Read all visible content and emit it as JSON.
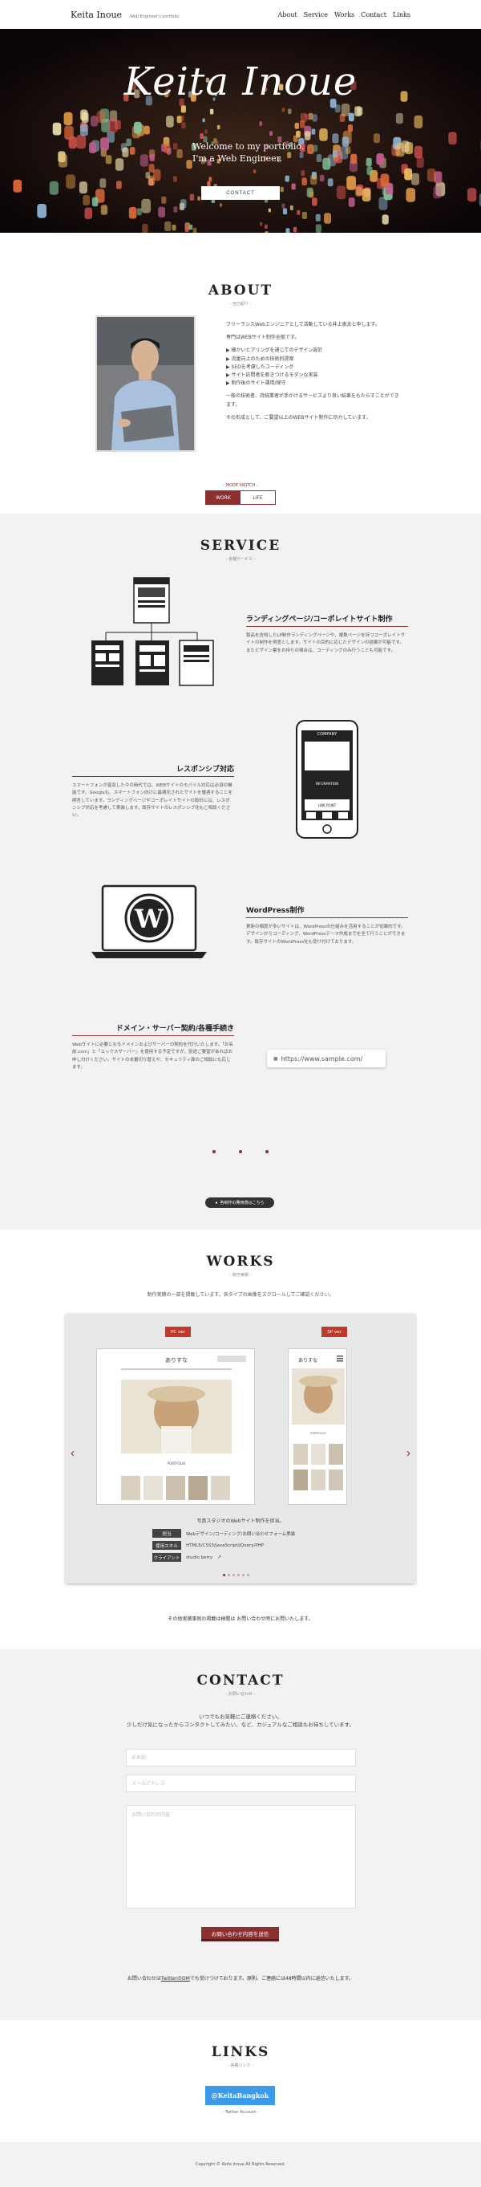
{
  "header": {
    "brand_name": "Keita Inoue",
    "brand_sub": "Web Engineer's portfolio",
    "nav": [
      "About",
      "Service",
      "Works",
      "Contact",
      "Links"
    ]
  },
  "hero": {
    "title": "Keita Inoue",
    "subtitle_line1": "Welcome to my portfolio.",
    "subtitle_line2": "I'm a Web Engineer.",
    "cta": "CONTACT"
  },
  "about": {
    "title": "ABOUT",
    "subtitle": "- 自己紹介 -",
    "p1": "フリーランスWebエンジニアとして活動している井上恵太と申します。",
    "p2": "専門はWEBサイト制作全般です。",
    "list": [
      "▶ 細かいヒアリングを通じてのデザイン設計",
      "▶ 流量向上のための技術的提案",
      "▶ SEOを考慮したコーディング",
      "▶ サイト訪問者を惹きつけるモダンな実装",
      "▶ 制作後のサイト運用/保守"
    ],
    "p3": "一般の技術者、持続業者が手がけるサービスより良い結果をもたらすことができます。",
    "p4": "その形成として、ご要望以上のWEBサイト制作に尽力しています。",
    "mode_label": "- MODE SWITCH -",
    "mode_on": "WORK",
    "mode_off": "LIFE"
  },
  "service": {
    "title": "SERVICE",
    "subtitle": "- 各種サービス -",
    "items": [
      {
        "title": "ランディングページ/コーポレイトサイト制作",
        "body": "製品を告知したLP制作ランディングページや、複数ページを持つコーポレイトサイトの制作を得意とします。サイトの目的に応じたデザインの提案が可能です。またビザイン書をお持ちの場合は、コーディングのみ行うことも可能です。"
      },
      {
        "title": "レスポンシブ対応",
        "body": "スマートフォンが普及した今の時代では、WEBサイトのモバイル対応は必須の機能です。Googleも、スマートフォン向けに最適化されたサイトを優遇することを明言しています。ランディングページやコーポレイトサイトの設計には、レスポンシブ対応を考慮して実装します。既存サイトのレスポンシブ化もご相談ください。"
      },
      {
        "title": "WordPress制作",
        "body": "更新の頻度が多いサイトは、WordPressの仕組みを活用することが効果的です。デザインからコーディング、WordPressテーマ作成までを全て行うことができます。既存サイトのWordPress化も受け付けております。"
      },
      {
        "title": "ドメイン・サーバー契約/各種手続き",
        "body": "Webサイトに必要となるドメインおよびサーバーの契約を代行いたします。「お名前.com」と「エックスサーバー」を使用する予定ですが、別途ご要望があればお申し付けください。サイトの本番切り替えや、セキュリティ面のご相談にも応じます。"
      }
    ],
    "phone_company": "COMPANY",
    "phone_info": "INFORMATION",
    "phone_link": "LINK POINT",
    "url_sample": "https://www.sample.com/",
    "more_btn": "各制作の費用感はこちら"
  },
  "works": {
    "title": "WORKS",
    "subtitle": "- 制作実績 -",
    "intro": "制作実績の一部を掲載しています。各タイプの画像をスクロールしてご確認ください。",
    "tag_pc": "PC ver",
    "tag_sp": "SP ver",
    "mock_logo": "ありすな",
    "mock_caption": "PORTFOLIO",
    "desc": "写真スタジオのWebサイト制作を担当。",
    "specs": [
      {
        "k": "担当",
        "v": "Webデザイン/コーディング/お問い合わせフォーム実装"
      },
      {
        "k": "使用スキル",
        "v": "HTML5/CSS3/JavaScript/jQuery/PHP"
      },
      {
        "k": "クライアント",
        "v": "studio berry"
      }
    ],
    "note": "その他実績事例の掲載は検閲は お問い合わせ時にお問いたします。"
  },
  "contact": {
    "title": "CONTACT",
    "subtitle": "- お問い合わせ -",
    "intro_line1": "いつでもお気軽にご連絡ください。",
    "intro_line2": "少しだけ気になったからコンタクトしてみたい、など、カジュアルなご相談もお待ちしています。",
    "name_placeholder": "お名前",
    "email_placeholder": "メールアドレス",
    "message_placeholder": "お問い合わせ内容",
    "send": "お問い合わせ内容を送信",
    "note_prefix": "お問い合わせは",
    "note_link": "TwitterのDM",
    "note_suffix": "でも受けつけております。原則、ご連絡には48時間以内に返信いたします。"
  },
  "links": {
    "title": "LINKS",
    "subtitle": "- 各種リンク -",
    "twitter_handle": "@KeitaBangkok",
    "twitter_label": "- Twitter Account -"
  },
  "footer": {
    "copyright": "Copyright © Keita Inoue All Rights Reserved."
  }
}
